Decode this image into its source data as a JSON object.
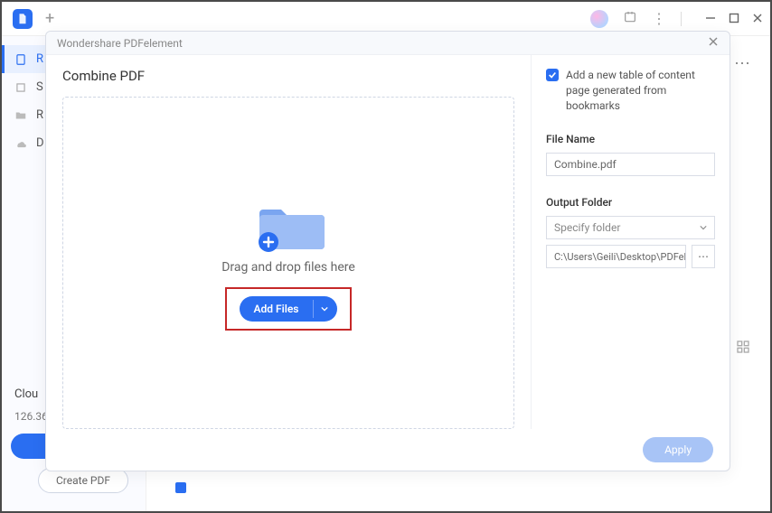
{
  "titlebar": {
    "plus": "+"
  },
  "sidebar": {
    "items": [
      {
        "label": "R"
      },
      {
        "label": "S"
      },
      {
        "label": "R"
      },
      {
        "label": "D"
      }
    ],
    "cloud_label": "Clou",
    "cloud_size": "126.36",
    "create_pdf": "Create PDF"
  },
  "dialog": {
    "app_name": "Wondershare PDFelement",
    "title": "Combine PDF",
    "dropzone_text": "Drag and drop files here",
    "add_files": "Add Files",
    "toc_checkbox": "Add a new table of content page generated from bookmarks",
    "file_name_label": "File Name",
    "file_name_value": "Combine.pdf",
    "output_folder_label": "Output Folder",
    "output_folder_select": "Specify folder",
    "output_path": "C:\\Users\\Geili\\Desktop\\PDFelement\\Cc",
    "apply": "Apply"
  }
}
